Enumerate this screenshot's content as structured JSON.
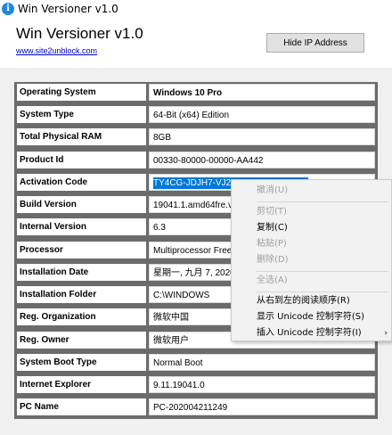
{
  "window": {
    "title": "Win Versioner v1.0",
    "icon": "info-icon",
    "icon_glyph": "i"
  },
  "header": {
    "app_name": "Win Versioner v1.0",
    "link_text": "www.site2unblock.com",
    "hide_ip_label": "Hide IP Address"
  },
  "rows": [
    {
      "label": "Operating System",
      "value": "Windows 10 Pro"
    },
    {
      "label": "System Type",
      "value": "64-Bit (x64) Edition"
    },
    {
      "label": "Total Physical RAM",
      "value": "8GB"
    },
    {
      "label": "Product Id",
      "value": "00330-80000-00000-AA442"
    },
    {
      "label": "Activation Code",
      "value": "TY4CG-JDJH7-VJ2WF-DY4X9-HCFC6"
    },
    {
      "label": "Build Version",
      "value": "19041.1.amd64fre.vb_release.191206-1406"
    },
    {
      "label": "Internal Version",
      "value": "6.3"
    },
    {
      "label": "Processor",
      "value": "Multiprocessor Free"
    },
    {
      "label": "Installation Date",
      "value": "星期一, 九月 7, 2020, 9:12:26"
    },
    {
      "label": "Installation Folder",
      "value": "C:\\WINDOWS"
    },
    {
      "label": "Reg. Organization",
      "value": "微软中国"
    },
    {
      "label": "Reg. Owner",
      "value": "微软用户"
    },
    {
      "label": "System Boot Type",
      "value": "Normal Boot"
    },
    {
      "label": "Internet Explorer",
      "value": "9.11.19041.0"
    },
    {
      "label": "PC Name",
      "value": "PC-202004211249"
    }
  ],
  "context_menu": {
    "items": [
      {
        "label": "撤消(U)",
        "enabled": false
      },
      {
        "label": "剪切(T)",
        "enabled": false
      },
      {
        "label": "复制(C)",
        "enabled": true
      },
      {
        "label": "粘贴(P)",
        "enabled": false
      },
      {
        "label": "删除(D)",
        "enabled": false
      },
      {
        "label": "全选(A)",
        "enabled": false
      },
      {
        "label": "从右到左的阅读顺序(R)",
        "enabled": true
      },
      {
        "label": "显示 Unicode 控制字符(S)",
        "enabled": true
      },
      {
        "label": "插入 Unicode 控制字符(I)",
        "enabled": true
      }
    ],
    "submenu_arrow": "›"
  },
  "colors": {
    "panel_bg": "#6b6b6b",
    "selection": "#0078d7",
    "link": "#0000cc"
  }
}
